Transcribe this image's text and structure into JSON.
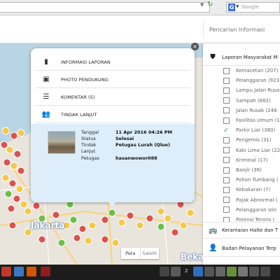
{
  "browser": {
    "search_engine": "Google",
    "search_engine_icon": "google-g-icon"
  },
  "map": {
    "search_placeholder": "Pencarian Informasi",
    "city_labels": [
      "Jakarta",
      "Bekasi"
    ],
    "map_type": {
      "map_label": "Peta",
      "satellite_label": "Satelit",
      "selected": "Peta"
    }
  },
  "popup": {
    "menu": [
      {
        "icon": "document-icon",
        "label": "INFORMASI LAPORAN"
      },
      {
        "icon": "photo-icon",
        "label": "PHOTO PENDUKUNG"
      },
      {
        "icon": "comment-list-icon",
        "label": "KOMENTAR (5)"
      },
      {
        "icon": "people-icon",
        "label": "TINDAK LANJUT"
      }
    ],
    "detail": {
      "rows": [
        {
          "label": "Tanggal",
          "value": "11 Apr 2016 04:26 PM"
        },
        {
          "label": "Status",
          "value": "Selesai"
        },
        {
          "label": "Tindak",
          "value": "Petugas Lurah (Qlue)"
        },
        {
          "label": "Lanjut",
          "value": ""
        },
        {
          "label": "Petugas",
          "value": "hasanwowor088"
        }
      ]
    }
  },
  "sidebar": {
    "header": {
      "icon": "shield-icon",
      "label": "Laporan Masyarakat M"
    },
    "categories": [
      {
        "label": "Kemacetan (207)",
        "checked": false
      },
      {
        "label": "Pelanggaran (923",
        "checked": false
      },
      {
        "label": "Lampu Jalan Rusa",
        "checked": false
      },
      {
        "label": "Sampah (682)",
        "checked": false
      },
      {
        "label": "Jalan Rusak (246",
        "checked": false
      },
      {
        "label": "Fasilitas Umum (1",
        "checked": false
      },
      {
        "label": "Parkir Liar (380)",
        "checked": true
      },
      {
        "label": "Pengemis (31)",
        "checked": false
      },
      {
        "label": "Kaki Lima Liar (22",
        "checked": false
      },
      {
        "label": "Kriminal (17)",
        "checked": false
      },
      {
        "label": "Banjir (36)",
        "checked": false
      },
      {
        "label": "Pohon Tumbang (",
        "checked": false
      },
      {
        "label": "Kebakaran (7)",
        "checked": false
      },
      {
        "label": "Pajak Abnormal (",
        "checked": false
      },
      {
        "label": "Pelanggaran Izin",
        "checked": false
      },
      {
        "label": "Potensi Teroris (",
        "checked": false
      }
    ],
    "sections": [
      {
        "icon": "bus-icon",
        "label": "Keramaian Halte dan T"
      },
      {
        "icon": "person-icon",
        "label": "Badan Pelayanan Terp"
      }
    ]
  },
  "taskbar": {
    "tray_number": "2"
  },
  "colors": {
    "sea": "#b9d4e4",
    "land": "#e9e5dc",
    "detail_bg": "#ddeefa",
    "checked_green": "#5a9b6c",
    "marker_yellow": "#f2c94c",
    "marker_red": "#d9534f",
    "marker_green": "#6cbf4a"
  }
}
